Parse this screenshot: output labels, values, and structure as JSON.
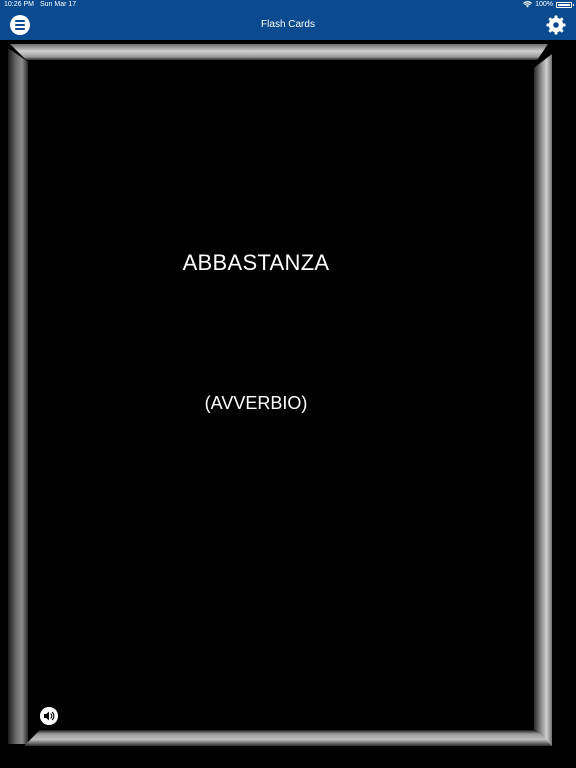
{
  "status_bar": {
    "time": "10:26 PM",
    "date": "Sun Mar 17",
    "battery": "100%"
  },
  "header": {
    "title": "Flash Cards",
    "menu_icon": "menu-icon",
    "settings_icon": "gear-icon",
    "background_color": "#0a4a8f"
  },
  "card": {
    "word": "ABBASTANZA",
    "part_of_speech": "(AVVERBIO)",
    "audio_icon": "speaker-icon"
  }
}
